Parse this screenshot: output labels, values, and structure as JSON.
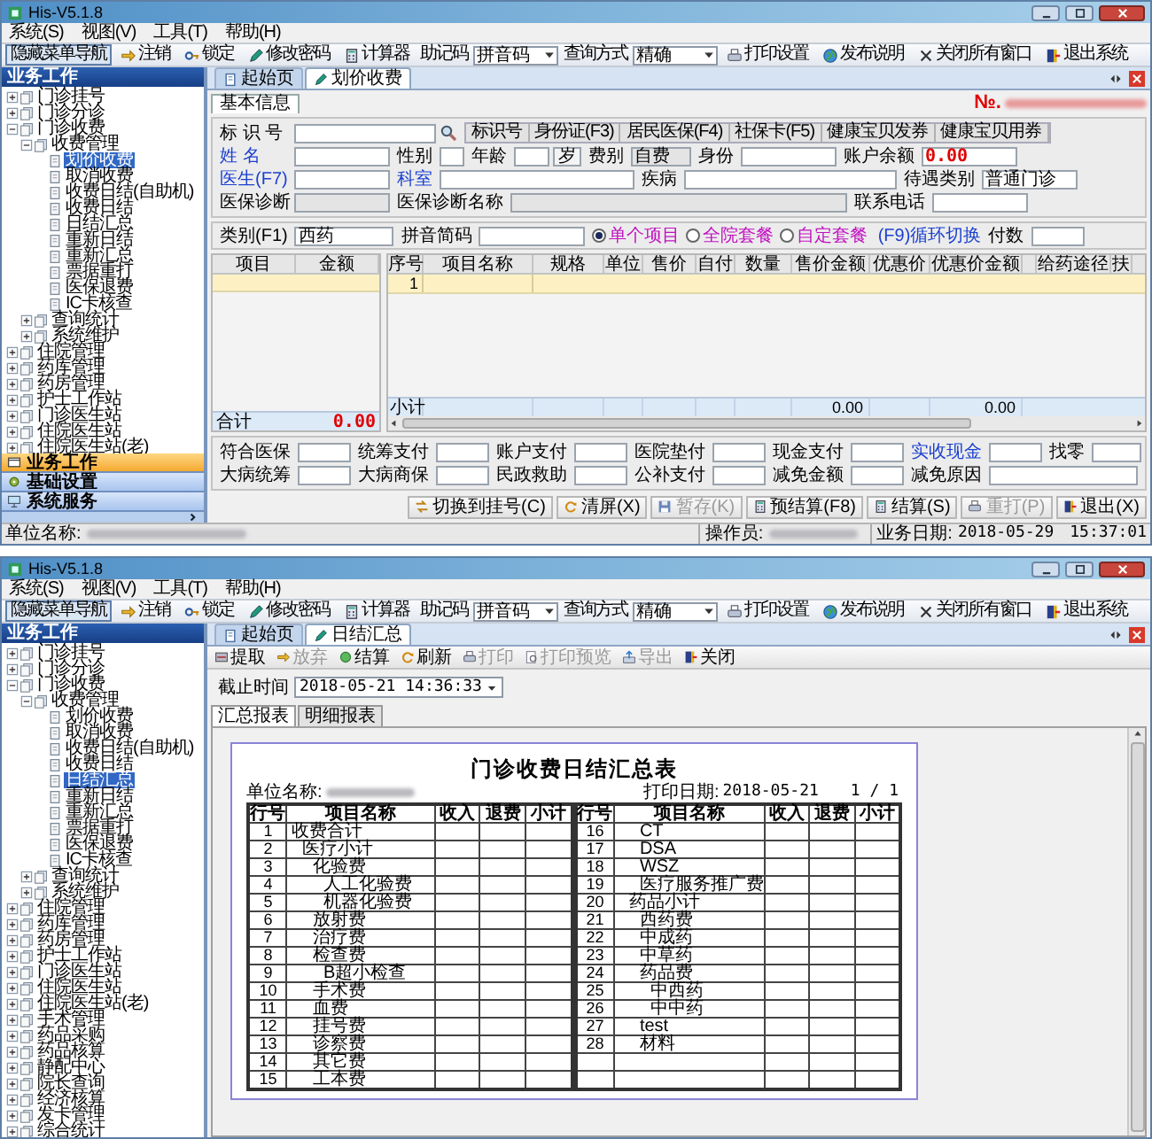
{
  "windows": [
    {
      "kind": "charge",
      "title": "His-V5.1.8",
      "menu": [
        "系统(S)",
        "视图(V)",
        "工具(T)",
        "帮助(H)"
      ],
      "toolbar": [
        {
          "kind": "button",
          "label": "隐藏菜单导航",
          "pressed": true
        },
        {
          "kind": "button",
          "label": "注销",
          "pressed": false
        },
        {
          "kind": "button",
          "label": "锁定",
          "pressed": false
        },
        {
          "kind": "button",
          "label": "修改密码",
          "pressed": false
        },
        {
          "kind": "button",
          "label": "计算器",
          "pressed": false
        },
        {
          "kind": "select",
          "label": "助记码",
          "value": "拼音码"
        },
        {
          "kind": "select",
          "label": "查询方式",
          "value": "精确"
        },
        {
          "kind": "button",
          "label": "打印设置",
          "pressed": false
        },
        {
          "kind": "button",
          "label": "发布说明",
          "pressed": false
        },
        {
          "kind": "button",
          "label": "关闭所有窗口",
          "pressed": false
        },
        {
          "kind": "button",
          "label": "退出系统",
          "pressed": false
        }
      ],
      "sidebar": {
        "header": "业务工作",
        "tree": [
          {
            "label": "门诊挂号",
            "expanded": false,
            "selected": false
          },
          {
            "label": "门诊分诊",
            "expanded": false,
            "selected": false
          },
          {
            "label": "门诊收费",
            "expanded": true,
            "selected": false,
            "children": [
              {
                "label": "收费管理",
                "expanded": true,
                "selected": false,
                "children": [
                  {
                    "label": "划价收费",
                    "selected": true
                  },
                  {
                    "label": "取消收费",
                    "selected": false
                  },
                  {
                    "label": "收费日结(自助机)",
                    "selected": false
                  },
                  {
                    "label": "收费日结",
                    "selected": false
                  },
                  {
                    "label": "日结汇总",
                    "selected": false
                  },
                  {
                    "label": "重新日结",
                    "selected": false
                  },
                  {
                    "label": "重新汇总",
                    "selected": false
                  },
                  {
                    "label": "票据重打",
                    "selected": false
                  },
                  {
                    "label": "医保退费",
                    "selected": false
                  },
                  {
                    "label": "IC卡核查",
                    "selected": false
                  }
                ]
              },
              {
                "label": "查询统计",
                "expanded": false,
                "selected": false
              },
              {
                "label": "系统维护",
                "expanded": false,
                "selected": false
              }
            ]
          },
          {
            "label": "住院管理",
            "expanded": false,
            "selected": false
          },
          {
            "label": "药库管理",
            "expanded": false,
            "selected": false
          },
          {
            "label": "药房管理",
            "expanded": false,
            "selected": false
          },
          {
            "label": "护士工作站",
            "expanded": false,
            "selected": false
          },
          {
            "label": "门诊医生站",
            "expanded": false,
            "selected": false
          },
          {
            "label": "住院医生站",
            "expanded": false,
            "selected": false
          },
          {
            "label": "住院医生站(老)",
            "expanded": false,
            "selected": false
          }
        ],
        "nav_sections": [
          {
            "label": "业务工作",
            "selected": true
          },
          {
            "label": "基础设置",
            "selected": false
          },
          {
            "label": "系统服务",
            "selected": false
          }
        ]
      },
      "tabs": [
        {
          "label": "起始页",
          "selected": false
        },
        {
          "label": "划价收费",
          "selected": true
        }
      ],
      "subtab": "基本信息",
      "number_label": "№.",
      "id_field": {
        "label": "标 识 号",
        "emphasized": false,
        "disabled": false
      },
      "id_buttons": [
        "标识号",
        "身份证(F3)",
        "居民医保(F4)",
        "社保卡(F5)",
        "健康宝贝发券",
        "健康宝贝用券"
      ],
      "field_rows": [
        [
          {
            "label": "姓 名",
            "emphasized": true,
            "disabled": false
          },
          {
            "label": "性别",
            "emphasized": false,
            "disabled": false
          },
          {
            "label": "年龄",
            "unit": "岁",
            "emphasized": false,
            "disabled": false
          },
          {
            "label": "费别",
            "value": "自费",
            "emphasized": false,
            "disabled": true
          },
          {
            "label": "身份",
            "emphasized": false,
            "disabled": false
          },
          {
            "label": "账户余额",
            "value": "0.00",
            "kind": "amount",
            "emphasized": false,
            "disabled": false
          }
        ],
        [
          {
            "label": "医生(F7)",
            "emphasized": true,
            "disabled": false
          },
          {
            "label": "科室",
            "emphasized": true,
            "disabled": false
          },
          {
            "label": "疾病",
            "emphasized": false,
            "disabled": false
          },
          {
            "label": "待遇类别",
            "value": "普通门诊",
            "emphasized": false,
            "disabled": false
          }
        ],
        [
          {
            "label": "医保诊断",
            "emphasized": false,
            "disabled": true
          },
          {
            "label": "医保诊断名称",
            "emphasized": false,
            "disabled": true
          },
          {
            "label": "联系电话",
            "emphasized": false,
            "disabled": false
          }
        ]
      ],
      "category": {
        "label": "类别(F1)",
        "value": "西药",
        "emphasized": false,
        "disabled": false
      },
      "pinyin": {
        "label": "拼音简码",
        "emphasized": false,
        "disabled": false
      },
      "modes": [
        {
          "label": "单个项目",
          "selected": true
        },
        {
          "label": "全院套餐",
          "selected": false
        },
        {
          "label": "自定套餐",
          "selected": false
        }
      ],
      "mode_hint": "(F9)循环切换",
      "doses": {
        "label": "付数",
        "emphasized": false,
        "disabled": false
      },
      "summary_table": {
        "columns": [
          "项目",
          "金额"
        ],
        "total_label": "合计",
        "total": "0.00"
      },
      "items_table": {
        "columns": [
          "序号",
          "项目名称",
          "规格",
          "单位",
          "售价",
          "自付",
          "数量",
          "售价金额",
          "优惠价",
          "优惠价金额",
          "给药途径",
          "扶"
        ],
        "rows": [
          {
            "number": "1",
            "selected": true
          }
        ],
        "subtotal_label": "小计",
        "sale_amount_total": "0.00",
        "discount_amount_total": "0.00"
      },
      "payment_rows": [
        [
          {
            "label": "符合医保",
            "emphasized": false,
            "disabled": false
          },
          {
            "label": "统筹支付",
            "emphasized": false,
            "disabled": false
          },
          {
            "label": "账户支付",
            "emphasized": false,
            "disabled": false
          },
          {
            "label": "医院垫付",
            "emphasized": false,
            "disabled": false
          },
          {
            "label": "现金支付",
            "emphasized": false,
            "disabled": false
          },
          {
            "label": "实收现金",
            "emphasized": true,
            "disabled": false
          },
          {
            "label": "找零",
            "emphasized": false,
            "disabled": false
          }
        ],
        [
          {
            "label": "大病统筹",
            "emphasized": false,
            "disabled": false
          },
          {
            "label": "大病商保",
            "emphasized": false,
            "disabled": false
          },
          {
            "label": "民政救助",
            "emphasized": false,
            "disabled": false
          },
          {
            "label": "公补支付",
            "emphasized": false,
            "disabled": false
          },
          {
            "label": "减免金额",
            "emphasized": false,
            "disabled": false
          },
          {
            "label": "减免原因",
            "emphasized": false,
            "disabled": false
          }
        ]
      ],
      "actions": [
        {
          "label": "切换到挂号(C)",
          "disabled": false
        },
        {
          "label": "清屏(X)",
          "disabled": false
        },
        {
          "label": "暂存(K)",
          "disabled": true
        },
        {
          "label": "预结算(F8)",
          "disabled": false
        },
        {
          "label": "结算(S)",
          "disabled": false
        },
        {
          "label": "重打(P)",
          "disabled": true
        },
        {
          "label": "退出(X)",
          "disabled": false
        }
      ],
      "status_bar": {
        "unit_label": "单位名称:",
        "operator_label": "操作员:",
        "date_label": "业务日期:",
        "date": "2018-05-29",
        "time": "15:37:01"
      }
    },
    {
      "kind": "report",
      "title": "His-V5.1.8",
      "menu": [
        "系统(S)",
        "视图(V)",
        "工具(T)",
        "帮助(H)"
      ],
      "toolbar": [
        {
          "kind": "button",
          "label": "隐藏菜单导航",
          "pressed": true
        },
        {
          "kind": "button",
          "label": "注销",
          "pressed": false
        },
        {
          "kind": "button",
          "label": "锁定",
          "pressed": false
        },
        {
          "kind": "button",
          "label": "修改密码",
          "pressed": false
        },
        {
          "kind": "button",
          "label": "计算器",
          "pressed": false
        },
        {
          "kind": "select",
          "label": "助记码",
          "value": "拼音码"
        },
        {
          "kind": "select",
          "label": "查询方式",
          "value": "精确"
        },
        {
          "kind": "button",
          "label": "打印设置",
          "pressed": false
        },
        {
          "kind": "button",
          "label": "发布说明",
          "pressed": false
        },
        {
          "kind": "button",
          "label": "关闭所有窗口",
          "pressed": false
        },
        {
          "kind": "button",
          "label": "退出系统",
          "pressed": false
        }
      ],
      "sidebar": {
        "header": "业务工作",
        "tree": [
          {
            "label": "门诊挂号",
            "expanded": false,
            "selected": false
          },
          {
            "label": "门诊分诊",
            "expanded": false,
            "selected": false
          },
          {
            "label": "门诊收费",
            "expanded": true,
            "selected": false,
            "children": [
              {
                "label": "收费管理",
                "expanded": true,
                "selected": false,
                "children": [
                  {
                    "label": "划价收费",
                    "selected": false
                  },
                  {
                    "label": "取消收费",
                    "selected": false
                  },
                  {
                    "label": "收费日结(自助机)",
                    "selected": false
                  },
                  {
                    "label": "收费日结",
                    "selected": false
                  },
                  {
                    "label": "日结汇总",
                    "selected": true
                  },
                  {
                    "label": "重新日结",
                    "selected": false
                  },
                  {
                    "label": "重新汇总",
                    "selected": false
                  },
                  {
                    "label": "票据重打",
                    "selected": false
                  },
                  {
                    "label": "医保退费",
                    "selected": false
                  },
                  {
                    "label": "IC卡核查",
                    "selected": false
                  }
                ]
              },
              {
                "label": "查询统计",
                "expanded": false,
                "selected": false
              },
              {
                "label": "系统维护",
                "expanded": false,
                "selected": false
              }
            ]
          },
          {
            "label": "住院管理",
            "expanded": false,
            "selected": false
          },
          {
            "label": "药库管理",
            "expanded": false,
            "selected": false
          },
          {
            "label": "药房管理",
            "expanded": false,
            "selected": false
          },
          {
            "label": "护士工作站",
            "expanded": false,
            "selected": false
          },
          {
            "label": "门诊医生站",
            "expanded": false,
            "selected": false
          },
          {
            "label": "住院医生站",
            "expanded": false,
            "selected": false
          },
          {
            "label": "住院医生站(老)",
            "expanded": false,
            "selected": false
          },
          {
            "label": "手术管理",
            "expanded": false,
            "selected": false
          },
          {
            "label": "药品采购",
            "expanded": false,
            "selected": false
          },
          {
            "label": "药品核算",
            "expanded": false,
            "selected": false
          },
          {
            "label": "静配中心",
            "expanded": false,
            "selected": false
          },
          {
            "label": "院长查询",
            "expanded": false,
            "selected": false
          },
          {
            "label": "经济核算",
            "expanded": false,
            "selected": false
          },
          {
            "label": "发卡管理",
            "expanded": false,
            "selected": false
          },
          {
            "label": "综合统计",
            "expanded": false,
            "selected": false
          }
        ]
      },
      "tabs": [
        {
          "label": "起始页",
          "selected": false
        },
        {
          "label": "日结汇总",
          "selected": true
        }
      ],
      "report_toolbar": [
        {
          "label": "提取",
          "disabled": false
        },
        {
          "label": "放弃",
          "disabled": true
        },
        {
          "label": "结算",
          "disabled": false
        },
        {
          "label": "刷新",
          "disabled": false
        },
        {
          "label": "打印",
          "disabled": true
        },
        {
          "label": "打印预览",
          "disabled": true
        },
        {
          "label": "导出",
          "disabled": true
        },
        {
          "label": "关闭",
          "disabled": false
        }
      ],
      "cutoff": {
        "label": "截止时间",
        "value": "2018-05-21 14:36:33"
      },
      "report_tabs": [
        {
          "label": "汇总报表",
          "selected": true
        },
        {
          "label": "明细报表",
          "selected": false
        }
      ],
      "report": {
        "title": "门诊收费日结汇总表",
        "unit_label": "单位名称:",
        "print_date_label": "打印日期:",
        "print_date": "2018-05-21",
        "page": "1 / 1",
        "column_groups": [
          [
            "行号",
            "项目名称",
            "收入",
            "退费",
            "小计"
          ],
          [
            "行号",
            "项目名称",
            "收入",
            "退费",
            "小计"
          ]
        ],
        "items": [
          {
            "no": "1",
            "name": "收费合计",
            "children": [
              {
                "no": "2",
                "name": "医疗小计",
                "children": [
                  {
                    "no": "3",
                    "name": "化验费",
                    "children": [
                      {
                        "no": "4",
                        "name": "人工化验费"
                      },
                      {
                        "no": "5",
                        "name": "机器化验费"
                      }
                    ]
                  },
                  {
                    "no": "6",
                    "name": "放射费"
                  },
                  {
                    "no": "7",
                    "name": "治疗费"
                  },
                  {
                    "no": "8",
                    "name": "检查费",
                    "children": [
                      {
                        "no": "9",
                        "name": "B超小检查"
                      }
                    ]
                  },
                  {
                    "no": "10",
                    "name": "手术费"
                  },
                  {
                    "no": "11",
                    "name": "血费"
                  },
                  {
                    "no": "12",
                    "name": "挂号费"
                  },
                  {
                    "no": "13",
                    "name": "诊察费"
                  },
                  {
                    "no": "14",
                    "name": "其它费"
                  },
                  {
                    "no": "15",
                    "name": "工本费"
                  },
                  {
                    "no": "16",
                    "name": "CT"
                  },
                  {
                    "no": "17",
                    "name": "DSA"
                  },
                  {
                    "no": "18",
                    "name": "WSZ"
                  },
                  {
                    "no": "19",
                    "name": "医疗服务推广费"
                  }
                ]
              },
              {
                "no": "20",
                "name": "药品小计",
                "children": [
                  {
                    "no": "21",
                    "name": "西药费"
                  },
                  {
                    "no": "22",
                    "name": "中成药"
                  },
                  {
                    "no": "23",
                    "name": "中草药"
                  },
                  {
                    "no": "24",
                    "name": "药品费",
                    "children": [
                      {
                        "no": "25",
                        "name": "中西药"
                      },
                      {
                        "no": "26",
                        "name": "中中药"
                      }
                    ]
                  },
                  {
                    "no": "27",
                    "name": "test"
                  },
                  {
                    "no": "28",
                    "name": "材料"
                  }
                ]
              }
            ]
          }
        ]
      }
    }
  ]
}
